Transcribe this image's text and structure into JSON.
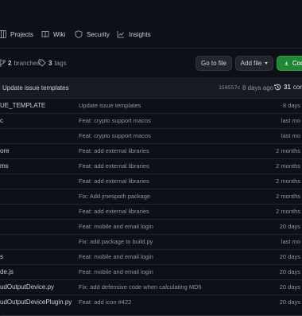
{
  "tabs": [
    {
      "label": "Projects",
      "icon": "table-icon"
    },
    {
      "label": "Wiki",
      "icon": "book-icon"
    },
    {
      "label": "Security",
      "icon": "shield-icon"
    },
    {
      "label": "Insights",
      "icon": "graph-icon"
    }
  ],
  "meta": {
    "branches_count": "2",
    "branches_label": "branches",
    "tags_count": "3",
    "tags_label": "tags"
  },
  "buttons": {
    "go_to_file": "Go to file",
    "add_file": "Add file",
    "code": "Code"
  },
  "latest_commit": {
    "message": "Update issue templates",
    "sha": "150557c",
    "date": "8 days ago",
    "count": "31",
    "count_label": "com"
  },
  "files": [
    {
      "name": "UE_TEMPLATE",
      "message": "Update issue templates",
      "age": "8 days"
    },
    {
      "name": "c",
      "message": "Feat: crypto support macos",
      "age": "last mo"
    },
    {
      "name": "",
      "message": "Feat: crypto support macos",
      "age": "last mo"
    },
    {
      "name": "ore",
      "message": "Feat: add external libraries",
      "age": "2 months"
    },
    {
      "name": "ms",
      "message": "Feat: add external libraries",
      "age": "2 months"
    },
    {
      "name": "",
      "message": "Feat: add external libraries",
      "age": "2 months"
    },
    {
      "name": "",
      "message": "Fix: Add jmespath package",
      "age": "2 months"
    },
    {
      "name": "",
      "message": "Feat: add external libraries",
      "age": "2 months"
    },
    {
      "name": "",
      "message": "Feat: mobile and email login",
      "age": "20 days"
    },
    {
      "name": "",
      "message": "Fix: add package to build.py",
      "age": "last mo"
    },
    {
      "name": "s",
      "message": "Feat: mobile and email login",
      "age": "20 days"
    },
    {
      "name": "de.js",
      "message": "Feat: mobile and email login",
      "age": "20 days"
    },
    {
      "name": "udOutputDevice.py",
      "message": "Fix: add defensive code when calculating MD5",
      "age": "20 days"
    },
    {
      "name": "udOutputDevicePlugin.py",
      "message": "Feat: add icon #422",
      "age": "20 days"
    }
  ]
}
